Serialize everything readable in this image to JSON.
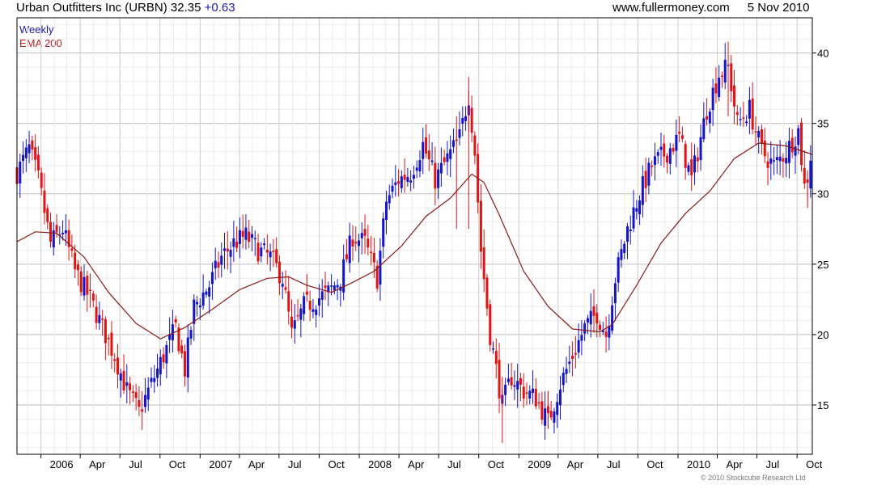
{
  "header": {
    "title": "Urban Outfitters Inc (URBN)",
    "price": "32.35",
    "change": "+0.63",
    "site": "www.fullermoney.com",
    "date": "5 Nov 2010"
  },
  "legend": {
    "period": "Weekly",
    "indicator": "EMA 200"
  },
  "copyright": "© 2010 Stockcube Research Ltd",
  "chart_data": {
    "type": "candlestick",
    "period": "weekly",
    "y_axis": {
      "position": "right",
      "range": [
        11.5,
        42.5
      ],
      "ticks": [
        15,
        20,
        25,
        30,
        35,
        40
      ]
    },
    "x_axis": {
      "range": [
        "2005-11-07",
        "2010-11-05"
      ],
      "ticks": [
        {
          "date": "2006-01-01",
          "label": "2006"
        },
        {
          "date": "2006-04-01",
          "label": "Apr"
        },
        {
          "date": "2006-07-01",
          "label": "Jul"
        },
        {
          "date": "2006-10-01",
          "label": "Oct"
        },
        {
          "date": "2007-01-01",
          "label": "2007"
        },
        {
          "date": "2007-04-01",
          "label": "Apr"
        },
        {
          "date": "2007-07-01",
          "label": "Jul"
        },
        {
          "date": "2007-10-01",
          "label": "Oct"
        },
        {
          "date": "2008-01-01",
          "label": "2008"
        },
        {
          "date": "2008-04-01",
          "label": "Apr"
        },
        {
          "date": "2008-07-01",
          "label": "Jul"
        },
        {
          "date": "2008-10-01",
          "label": "Oct"
        },
        {
          "date": "2009-01-01",
          "label": "2009"
        },
        {
          "date": "2009-04-01",
          "label": "Apr"
        },
        {
          "date": "2009-07-01",
          "label": "Jul"
        },
        {
          "date": "2009-10-01",
          "label": "Oct"
        },
        {
          "date": "2010-01-01",
          "label": "2010"
        },
        {
          "date": "2010-04-01",
          "label": "Apr"
        },
        {
          "date": "2010-07-01",
          "label": "Jul"
        },
        {
          "date": "2010-10-01",
          "label": "Oct"
        }
      ]
    },
    "grid": true,
    "colors": {
      "up": "#1414c8",
      "down": "#e01414",
      "ema": "#8b1a1a",
      "grid": "#d4d4d4"
    },
    "close_path": [
      [
        "2005-11-07",
        31.5
      ],
      [
        "2005-12-05",
        33.2
      ],
      [
        "2005-12-26",
        31
      ],
      [
        "2006-01-23",
        26.5
      ],
      [
        "2006-02-20",
        27.5
      ],
      [
        "2006-03-20",
        24.5
      ],
      [
        "2006-04-24",
        22.5
      ],
      [
        "2006-05-22",
        20.5
      ],
      [
        "2006-06-19",
        18.5
      ],
      [
        "2006-07-17",
        16
      ],
      [
        "2006-08-14",
        14.5
      ],
      [
        "2006-09-11",
        16.5
      ],
      [
        "2006-10-09",
        18.5
      ],
      [
        "2006-11-06",
        20.5
      ],
      [
        "2006-11-27",
        17.5
      ],
      [
        "2006-12-18",
        22
      ],
      [
        "2007-01-22",
        23.5
      ],
      [
        "2007-02-19",
        25.5
      ],
      [
        "2007-03-19",
        26.5
      ],
      [
        "2007-04-16",
        27
      ],
      [
        "2007-05-14",
        26
      ],
      [
        "2007-06-11",
        25.5
      ],
      [
        "2007-07-09",
        24
      ],
      [
        "2007-07-30",
        20
      ],
      [
        "2007-08-27",
        22
      ],
      [
        "2007-09-24",
        22.5
      ],
      [
        "2007-10-22",
        23
      ],
      [
        "2007-11-19",
        24
      ],
      [
        "2007-12-17",
        27
      ],
      [
        "2008-01-14",
        26.5
      ],
      [
        "2008-02-11",
        24
      ],
      [
        "2008-03-03",
        29.5
      ],
      [
        "2008-03-31",
        31
      ],
      [
        "2008-04-28",
        31.5
      ],
      [
        "2008-05-26",
        33.5
      ],
      [
        "2008-06-23",
        31
      ],
      [
        "2008-07-21",
        32.5
      ],
      [
        "2008-08-18",
        34
      ],
      [
        "2008-09-08",
        37
      ],
      [
        "2008-09-22",
        33
      ],
      [
        "2008-10-06",
        26
      ],
      [
        "2008-10-27",
        20
      ],
      [
        "2008-11-24",
        15
      ],
      [
        "2008-12-15",
        17
      ],
      [
        "2009-01-12",
        16
      ],
      [
        "2009-02-09",
        15.5
      ],
      [
        "2009-03-09",
        13.8
      ],
      [
        "2009-04-06",
        16.5
      ],
      [
        "2009-05-04",
        18.5
      ],
      [
        "2009-06-01",
        20.5
      ],
      [
        "2009-06-29",
        21.5
      ],
      [
        "2009-07-20",
        20
      ],
      [
        "2009-08-10",
        24
      ],
      [
        "2009-09-07",
        27.5
      ],
      [
        "2009-10-05",
        30
      ],
      [
        "2009-11-02",
        32
      ],
      [
        "2009-12-07",
        33
      ],
      [
        "2010-01-04",
        34
      ],
      [
        "2010-02-01",
        31
      ],
      [
        "2010-03-08",
        36
      ],
      [
        "2010-04-05",
        38.5
      ],
      [
        "2010-04-26",
        39
      ],
      [
        "2010-05-17",
        35
      ],
      [
        "2010-06-14",
        36
      ],
      [
        "2010-07-12",
        33
      ],
      [
        "2010-08-09",
        32
      ],
      [
        "2010-09-06",
        33
      ],
      [
        "2010-10-04",
        34.5
      ],
      [
        "2010-10-18",
        30.5
      ],
      [
        "2010-11-05",
        32.35
      ]
    ],
    "ema_200": [
      [
        "2005-11-07",
        26.6
      ],
      [
        "2005-12-19",
        27.3
      ],
      [
        "2006-02-06",
        27.2
      ],
      [
        "2006-04-10",
        25.5
      ],
      [
        "2006-06-05",
        23
      ],
      [
        "2006-08-07",
        20.8
      ],
      [
        "2006-10-02",
        19.7
      ],
      [
        "2006-11-27",
        20.5
      ],
      [
        "2007-01-29",
        21.8
      ],
      [
        "2007-04-02",
        23.2
      ],
      [
        "2007-06-04",
        24
      ],
      [
        "2007-07-23",
        24.1
      ],
      [
        "2007-09-03",
        23.5
      ],
      [
        "2007-10-29",
        23
      ],
      [
        "2007-12-10",
        23.6
      ],
      [
        "2008-02-04",
        24.5
      ],
      [
        "2008-04-07",
        26.3
      ],
      [
        "2008-06-02",
        28.4
      ],
      [
        "2008-07-28",
        29.7
      ],
      [
        "2008-09-15",
        31.4
      ],
      [
        "2008-10-13",
        30.8
      ],
      [
        "2008-11-17",
        28.5
      ],
      [
        "2009-01-12",
        24.5
      ],
      [
        "2009-03-09",
        22
      ],
      [
        "2009-05-04",
        20.4
      ],
      [
        "2009-07-06",
        20.2
      ],
      [
        "2009-08-03",
        20.7
      ],
      [
        "2009-09-28",
        23.5
      ],
      [
        "2009-11-23",
        26.5
      ],
      [
        "2010-01-18",
        28.6
      ],
      [
        "2010-03-15",
        30.2
      ],
      [
        "2010-05-10",
        32.5
      ],
      [
        "2010-07-05",
        33.6
      ],
      [
        "2010-09-06",
        33.4
      ],
      [
        "2010-11-05",
        32.8
      ]
    ],
    "spikes": [
      [
        "2008-09-08",
        38.3,
        27.5
      ],
      [
        "2008-11-24",
        17,
        12.3
      ],
      [
        "2009-03-09",
        16,
        13.4
      ],
      [
        "2010-04-26",
        40.8,
        35.5
      ],
      [
        "2008-08-11",
        35.5,
        27.5
      ],
      [
        "2010-10-25",
        31.5,
        29
      ]
    ]
  }
}
